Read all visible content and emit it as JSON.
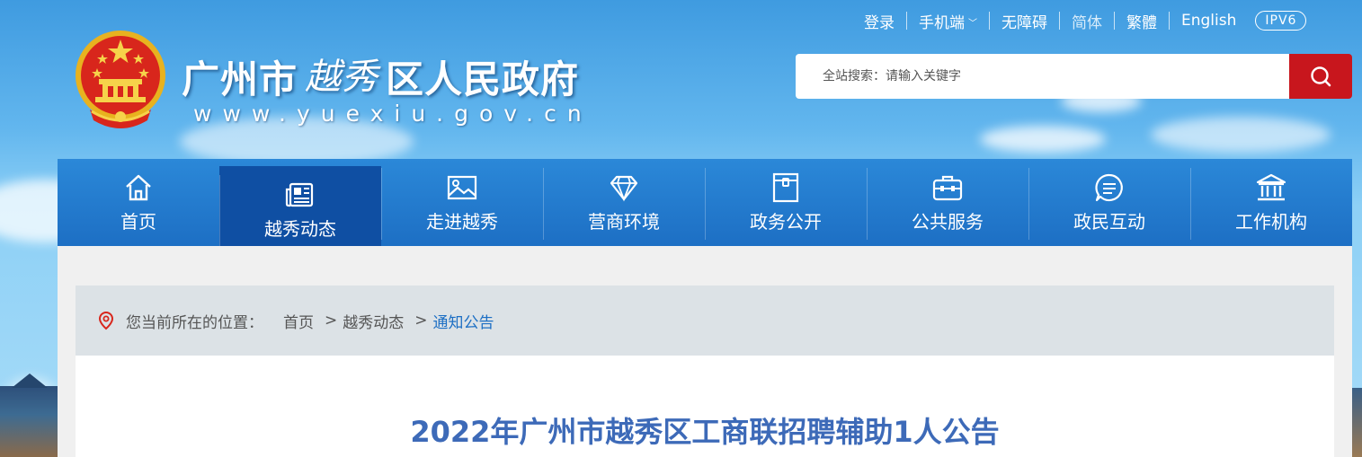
{
  "header": {
    "title_part1": "广州市",
    "title_calligraphy": "越秀",
    "title_part2": "区人民政府",
    "url": "www.yuexiu.gov.cn"
  },
  "toplinks": {
    "login": "登录",
    "mobile": "手机端",
    "accessible": "无障碍",
    "simplified": "简体",
    "traditional": "繁體",
    "english": "English",
    "ipv6": "IPV6"
  },
  "search": {
    "placeholder": "全站搜索：请输入关键字"
  },
  "nav": {
    "items": [
      {
        "label": "首页",
        "icon": "home-icon"
      },
      {
        "label": "越秀动态",
        "icon": "newspaper-icon"
      },
      {
        "label": "走进越秀",
        "icon": "picture-icon"
      },
      {
        "label": "营商环境",
        "icon": "diamond-icon"
      },
      {
        "label": "政务公开",
        "icon": "document-icon"
      },
      {
        "label": "公共服务",
        "icon": "briefcase-icon"
      },
      {
        "label": "政民互动",
        "icon": "chat-icon"
      },
      {
        "label": "工作机构",
        "icon": "institution-icon"
      }
    ],
    "active_index": 1
  },
  "breadcrumb": {
    "prefix": "您当前所在的位置：",
    "home": "首页",
    "section": "越秀动态",
    "current": "通知公告",
    "separator": ">"
  },
  "article": {
    "title": "2022年广州市越秀区工商联招聘辅助1人公告"
  },
  "colors": {
    "nav_bg": "#1d6fc4",
    "nav_active": "#0f4fa3",
    "search_button": "#c8161d",
    "title_color": "#3d6ab8"
  }
}
